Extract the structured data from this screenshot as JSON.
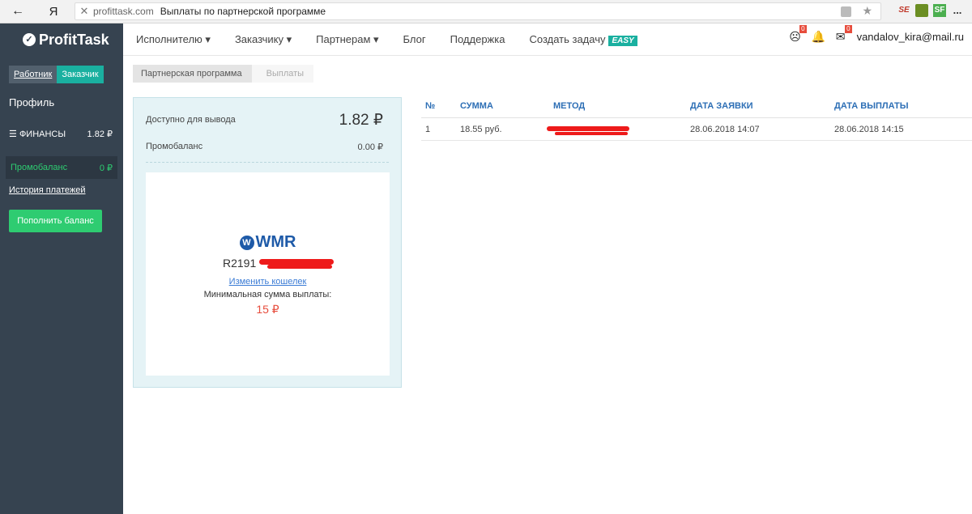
{
  "browser": {
    "back_label": "←",
    "ya_label": "Я",
    "close_label": "✕",
    "domain": "profittask.com",
    "page_title": "Выплаты по партнерской программе",
    "star_label": "★",
    "extensions": [
      "SE",
      "",
      "SF",
      "..."
    ]
  },
  "sidebar": {
    "logo_check": "✓",
    "logo": "ProfitTask",
    "role_worker": "Работник",
    "role_client": "Заказчик",
    "profile": "Профиль",
    "finance_label": "ФИНАНСЫ",
    "finance_value": "1.82 ₽",
    "promo_label": "Промобаланс",
    "promo_value": "0 ₽",
    "history": "История платежей",
    "topup": "Пополнить баланс"
  },
  "topnav": {
    "items": [
      "Исполнителю ▾",
      "Заказчику ▾",
      "Партнерам ▾",
      "Блог",
      "Поддержка",
      "Создать задачу"
    ],
    "easy": "EASY",
    "notif_count": "0",
    "mail_count": "0",
    "user_email": "vandalov_kira@mail.ru"
  },
  "breadcrumb": {
    "items": [
      "Партнерская программа",
      "Выплаты"
    ]
  },
  "wallet": {
    "available_label": "Доступно для вывода",
    "available_value": "1.82 ₽",
    "promo_label": "Промобаланс",
    "promo_value": "0.00 ₽",
    "wmr_symbol": "W",
    "wmr_label": "WMR",
    "wallet_number": "R2191",
    "change_wallet": "Изменить кошелек",
    "min_label": "Минимальная сумма выплаты:",
    "min_value": "15 ₽"
  },
  "payouts": {
    "headers": [
      "№",
      "СУММА",
      "МЕТОД",
      "ДАТА ЗАЯВКИ",
      "ДАТА ВЫПЛАТЫ"
    ],
    "rows": [
      {
        "num": "1",
        "amount": "18.55 руб.",
        "method": "",
        "request_date": "28.06.2018 14:07",
        "payout_date": "28.06.2018 14:15"
      }
    ]
  },
  "colors": {
    "sidebar_bg": "#364350",
    "accent": "#1ab0a0",
    "green": "#2ecc71",
    "link_blue": "#2c6eb5",
    "redaction": "#ee1a1a"
  }
}
